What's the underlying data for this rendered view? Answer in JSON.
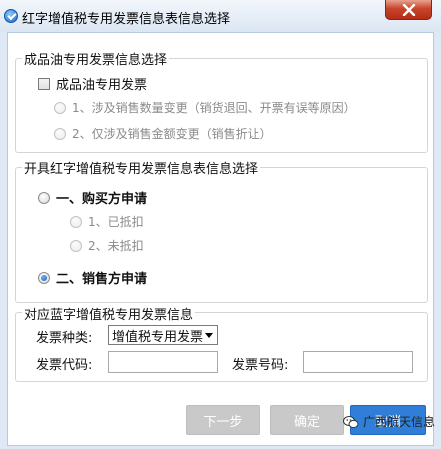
{
  "window": {
    "title": "红字增值税专用发票信息表信息选择"
  },
  "group1": {
    "legend": "成品油专用发票信息选择",
    "checkbox_label": "成品油专用发票",
    "option1": "1、涉及销售数量变更（销货退回、开票有误等原因）",
    "option2": "2、仅涉及销售金额变更（销售折让）"
  },
  "group2": {
    "legend": "开具红字增值税专用发票信息表信息选择",
    "buyer": "一、购买方申请",
    "buyer_sub1": "1、已抵扣",
    "buyer_sub2": "2、未抵扣",
    "seller": "二、销售方申请",
    "selected": "seller"
  },
  "group3": {
    "legend": "对应蓝字增值税专用发票信息",
    "type_label": "发票种类:",
    "type_value": "增值税专用发票",
    "code_label": "发票代码:",
    "code_value": "",
    "number_label": "发票号码:",
    "number_value": ""
  },
  "buttons": {
    "next": "下一步",
    "ok": "确定",
    "cancel": "取消"
  },
  "watermark": "广西航天信息"
}
